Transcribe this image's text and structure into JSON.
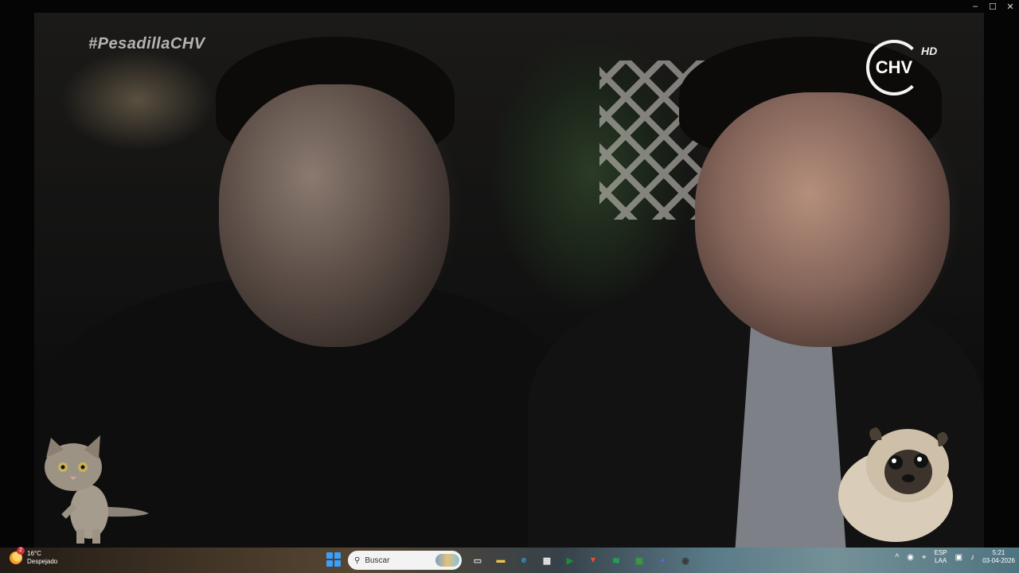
{
  "window": {
    "controls": {
      "minimize": "–",
      "maximize": "☐",
      "close": "✕"
    }
  },
  "video": {
    "hashtag": "#PesadillaCHV",
    "channel_logo": "CHV",
    "channel_logo_hd": "HD"
  },
  "pets": {
    "cat_icon": "cat-pet",
    "pug_icon": "pug-pet"
  },
  "taskbar": {
    "weather": {
      "badge": "2",
      "temperature": "16°C",
      "condition": "Despejado"
    },
    "search": {
      "placeholder": "Buscar"
    },
    "apps": [
      {
        "name": "task-view",
        "glyph": "▭",
        "color": "#dcdcdc"
      },
      {
        "name": "file-explorer",
        "glyph": "▬",
        "color": "#f2c14e"
      },
      {
        "name": "edge",
        "glyph": "e",
        "color": "#2f9fd6"
      },
      {
        "name": "microsoft-store",
        "glyph": "▦",
        "color": "#e9e9e9"
      },
      {
        "name": "app-green",
        "glyph": "▶",
        "color": "#1f8a3b"
      },
      {
        "name": "brave",
        "glyph": "▼",
        "color": "#e8502b"
      },
      {
        "name": "spotify",
        "glyph": "≋",
        "color": "#1db954"
      },
      {
        "name": "minecraft",
        "glyph": "▣",
        "color": "#3a9a3a"
      },
      {
        "name": "discord",
        "glyph": "◕",
        "color": "#5865f2"
      },
      {
        "name": "obs",
        "glyph": "◉",
        "color": "#3a3a3a"
      }
    ],
    "tray": {
      "language": "ESP",
      "layout": "LAA",
      "time": "5:21",
      "date": "03-04-2026"
    }
  }
}
